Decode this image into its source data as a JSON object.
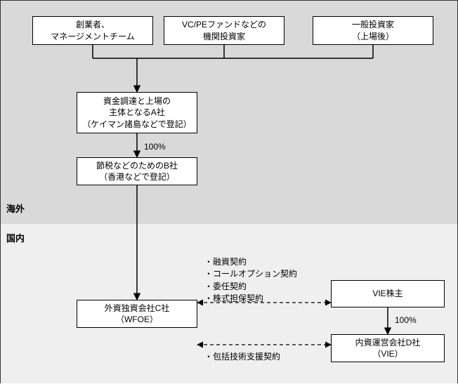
{
  "regions": {
    "overseas": "海外",
    "domestic": "国内"
  },
  "boxes": {
    "founders": "創業者、\nマネージメントチーム",
    "vcpe": "VC/PEファンドなどの\n機関投資家",
    "publicInvestors": "一般投資家\n（上場後）",
    "companyA": "資金調達と上場の\n主体となるA社\n（ケイマン諸島などで登記）",
    "companyB": "節税などのためのB社\n（香港などで登記）",
    "companyC": "外資独資会社C社\n（WFOE）",
    "vieHolder": "VIE株主",
    "companyD": "内資運営会社D社\n（VIE）"
  },
  "labels": {
    "hundredA": "100%",
    "hundredD": "100%",
    "contracts1": [
      "融資契約",
      "コールオプション契約",
      "委任契約",
      "株式担保契約"
    ],
    "contracts2": "包括技術支援契約"
  }
}
